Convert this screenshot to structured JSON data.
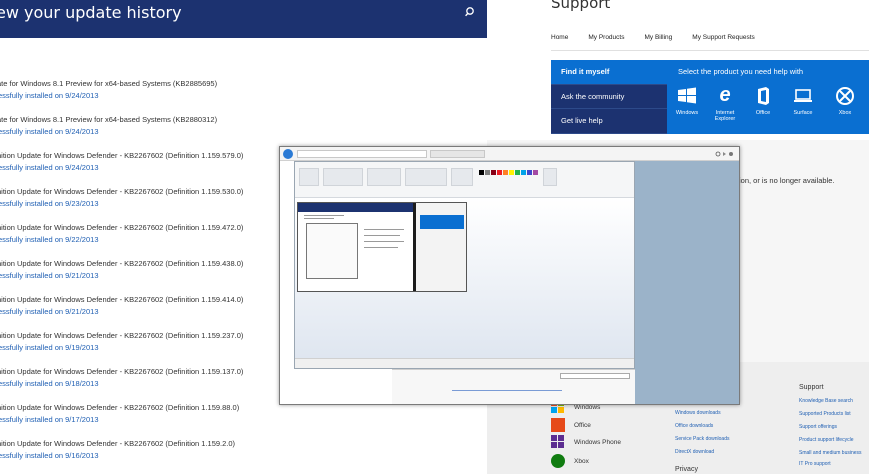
{
  "update_history": {
    "title": "ew your update history",
    "search_icon": "search-icon",
    "updates": [
      {
        "name": "ate for Windows 8.1 Preview for x64-based Systems (KB2885695)",
        "status": "essfully installed on 9/24/2013"
      },
      {
        "name": "ate for Windows 8.1 Preview for x64-based Systems (KB2880312)",
        "status": "essfully installed on 9/24/2013"
      },
      {
        "name": "nition Update for Windows Defender - KB2267602 (Definition 1.159.579.0)",
        "status": "essfully installed on 9/24/2013"
      },
      {
        "name": "nition Update for Windows Defender - KB2267602 (Definition 1.159.530.0)",
        "status": "essfully installed on 9/23/2013"
      },
      {
        "name": "nition Update for Windows Defender - KB2267602 (Definition 1.159.472.0)",
        "status": "essfully installed on 9/22/2013"
      },
      {
        "name": "nition Update for Windows Defender - KB2267602 (Definition 1.159.438.0)",
        "status": "essfully installed on 9/21/2013"
      },
      {
        "name": "nition Update for Windows Defender - KB2267602 (Definition 1.159.414.0)",
        "status": "essfully installed on 9/21/2013"
      },
      {
        "name": "nition Update for Windows Defender - KB2267602 (Definition 1.159.237.0)",
        "status": "essfully installed on 9/19/2013"
      },
      {
        "name": "nition Update for Windows Defender - KB2267602 (Definition 1.159.137.0)",
        "status": "essfully installed on 9/18/2013"
      },
      {
        "name": "nition Update for Windows Defender - KB2267602 (Definition 1.159.88.0)",
        "status": "essfully installed on 9/17/2013"
      },
      {
        "name": "nition Update for Windows Defender - KB2267602 (Definition 1.159.2.0)",
        "status": "essfully installed on 9/16/2013"
      }
    ]
  },
  "support": {
    "title": "Support",
    "nav": [
      "Home",
      "My Products",
      "My Billing",
      "My Support Requests"
    ],
    "help_menu": {
      "find_it": "Find it myself",
      "ask": "Ask the community",
      "live": "Get live help"
    },
    "product_heading": "Select the product you need help with",
    "products": [
      {
        "label": "Windows",
        "icon": "windows-icon"
      },
      {
        "label": "Internet Explorer",
        "icon": "internet-explorer-icon"
      },
      {
        "label": "Office",
        "icon": "office-icon"
      },
      {
        "label": "Surface",
        "icon": "surface-icon"
      },
      {
        "label": "Xbox",
        "icon": "xbox-icon"
      }
    ],
    "unavailable_text": "ion, or is no longer available.",
    "footer": {
      "products": [
        "Windows",
        "Office",
        "Windows Phone",
        "Xbox"
      ],
      "downloads_links": [
        "Windows downloads",
        "Office downloads",
        "Service Pack downloads",
        "DirectX download"
      ],
      "privacy_head": "Privacy",
      "support_head": "Support",
      "support_links": [
        "Knowledge Base search",
        "Supported Products list",
        "Support offerings",
        "Product support lifecycle",
        "Small and medium business",
        "IT Pro support"
      ]
    }
  },
  "colors": {
    "header_navy": "#1c3270",
    "accent_blue": "#0a6fd1",
    "link_blue": "#1f5fb3"
  }
}
